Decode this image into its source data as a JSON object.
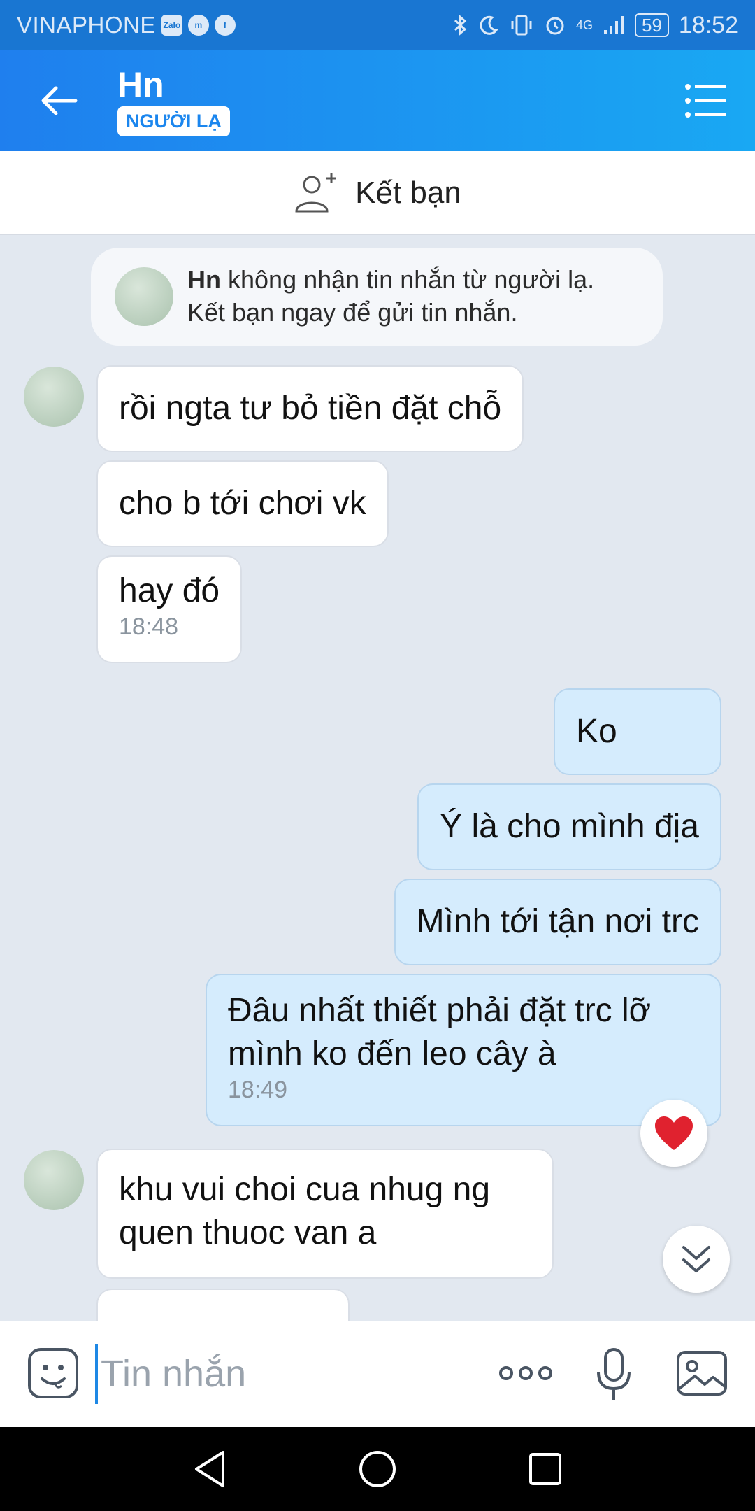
{
  "status_bar": {
    "carrier": "VINAPHONE",
    "app_icons": [
      "zalo-icon",
      "messenger-icon",
      "facebook-icon"
    ],
    "battery": "59",
    "network": "4G",
    "time": "18:52"
  },
  "header": {
    "contact_name": "Hn",
    "badge": "NGƯỜI LẠ"
  },
  "friend_bar": {
    "label": "Kết bạn"
  },
  "notice": {
    "name": "Hn",
    "line1": "không nhận tin nhắn từ người lạ.",
    "line2": "Kết bạn ngay để gửi tin nhắn."
  },
  "messages": [
    {
      "direction": "in",
      "text": "rồi ngta tư bỏ tiền đặt chỗ"
    },
    {
      "direction": "in",
      "text": "cho b tới chơi vk"
    },
    {
      "direction": "in",
      "text": "hay đó",
      "time": "18:48"
    },
    {
      "direction": "out",
      "text": "Ko"
    },
    {
      "direction": "out",
      "text": "Ý là cho mình địa"
    },
    {
      "direction": "out",
      "text": "Mình tới tận nơi trc"
    },
    {
      "direction": "out",
      "line1": "Đâu nhất thiết phải đặt trc lỡ",
      "line2": "mình ko đến leo cây à",
      "time": "18:49"
    },
    {
      "direction": "in",
      "line1": "khu vui choi cua nhug ng",
      "line2": "quen thuoc van a"
    }
  ],
  "composer": {
    "placeholder": "Tin nhắn"
  },
  "colors": {
    "header_start": "#1f7fee",
    "header_end": "#19a8f3",
    "out_bubble": "#d5ecfd",
    "chat_bg": "#e2e8f0"
  }
}
